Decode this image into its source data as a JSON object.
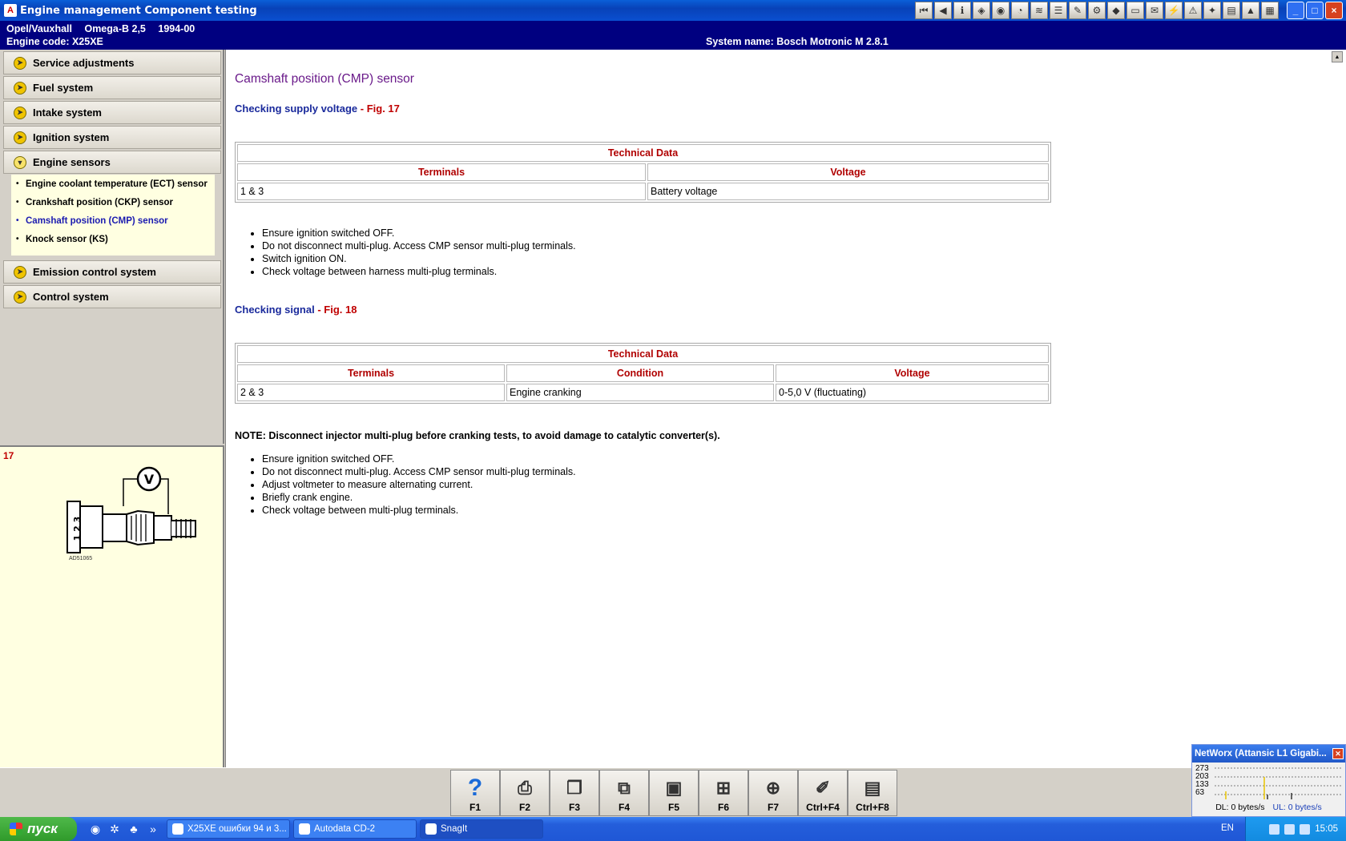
{
  "window": {
    "title": "Engine management Component testing",
    "app_icon": "autodata-icon"
  },
  "toolbar_icons": [
    "first-page-icon",
    "back-icon",
    "info-icon",
    "diagram-icon",
    "sensor-icon",
    "gauge-icon",
    "wiring-icon",
    "list-icon",
    "tools-icon",
    "parts-icon",
    "fluid-icon",
    "battery-icon",
    "notes-icon",
    "engine-icon",
    "warning-icon",
    "settings-icon",
    "print-icon",
    "car-icon",
    "menu-icon"
  ],
  "window_buttons": {
    "minimize": "_",
    "maximize": "□",
    "close": "×"
  },
  "vehicle": {
    "make": "Opel/Vauxhall",
    "model": "Omega-B 2,5",
    "years": "1994-00",
    "engine_code": "Engine code: X25XE",
    "system_name": "System name: Bosch Motronic M 2.8.1"
  },
  "nav": {
    "items": [
      {
        "label": "Service adjustments"
      },
      {
        "label": "Fuel system"
      },
      {
        "label": "Intake system"
      },
      {
        "label": "Ignition system"
      },
      {
        "label": "Engine sensors"
      },
      {
        "label": "Emission control system"
      },
      {
        "label": "Control system"
      }
    ],
    "sub_items": [
      {
        "label": "Engine coolant temperature (ECT) sensor"
      },
      {
        "label": "Crankshaft position (CKP) sensor"
      },
      {
        "label": "Camshaft position (CMP) sensor"
      },
      {
        "label": "Knock sensor (KS)"
      }
    ]
  },
  "figure": {
    "number": "17",
    "meter_label": "V",
    "pins": "1 2 3",
    "code": "AD51065"
  },
  "content": {
    "title": "Camshaft position (CMP) sensor",
    "section1": {
      "heading": "Checking supply voltage",
      "sep": " - ",
      "fig": "Fig. 17",
      "table": {
        "caption": "Technical Data",
        "headers": [
          "Terminals",
          "Voltage"
        ],
        "rows": [
          [
            "1 & 3",
            "Battery voltage"
          ]
        ]
      },
      "steps": [
        "Ensure ignition switched OFF.",
        "Do not disconnect multi-plug. Access CMP sensor multi-plug terminals.",
        "Switch ignition ON.",
        "Check voltage between harness multi-plug terminals."
      ]
    },
    "section2": {
      "heading": "Checking signal",
      "sep": " - ",
      "fig": "Fig. 18",
      "table": {
        "caption": "Technical Data",
        "headers": [
          "Terminals",
          "Condition",
          "Voltage"
        ],
        "rows": [
          [
            "2 & 3",
            "Engine cranking",
            "0-5,0 V (fluctuating)"
          ]
        ]
      },
      "note": "NOTE: Disconnect injector multi-plug before cranking tests, to avoid damage to catalytic converter(s).",
      "steps": [
        "Ensure ignition switched OFF.",
        "Do not disconnect multi-plug. Access CMP sensor multi-plug terminals.",
        "Adjust voltmeter to measure alternating current.",
        "Briefly crank engine.",
        "Check voltage between multi-plug terminals."
      ]
    }
  },
  "function_keys": [
    {
      "label": "F1",
      "icon": "help-icon"
    },
    {
      "label": "F2",
      "icon": "print-icon"
    },
    {
      "label": "F3",
      "icon": "copy-page-icon"
    },
    {
      "label": "F4",
      "icon": "search-page-icon"
    },
    {
      "label": "F5",
      "icon": "tech-data-icon"
    },
    {
      "label": "F6",
      "icon": "connector-icon"
    },
    {
      "label": "F7",
      "icon": "zoom-icon"
    },
    {
      "label": "Ctrl+F4",
      "icon": "notes-pencil-icon"
    },
    {
      "label": "Ctrl+F8",
      "icon": "table-list-icon"
    }
  ],
  "networx": {
    "title": "NetWorx (Attansic L1 Gigabi...",
    "scale": [
      "273",
      "203",
      "133",
      "63"
    ],
    "dl": "DL: 0 bytes/s",
    "ul": "UL: 0 bytes/s"
  },
  "taskbar": {
    "start_label": "пуск",
    "tasks": [
      {
        "label": "X25XE ошибки 94 и 3..."
      },
      {
        "label": "Autodata CD-2"
      },
      {
        "label": "SnagIt"
      }
    ],
    "lang": "EN",
    "clock": "15:05"
  }
}
